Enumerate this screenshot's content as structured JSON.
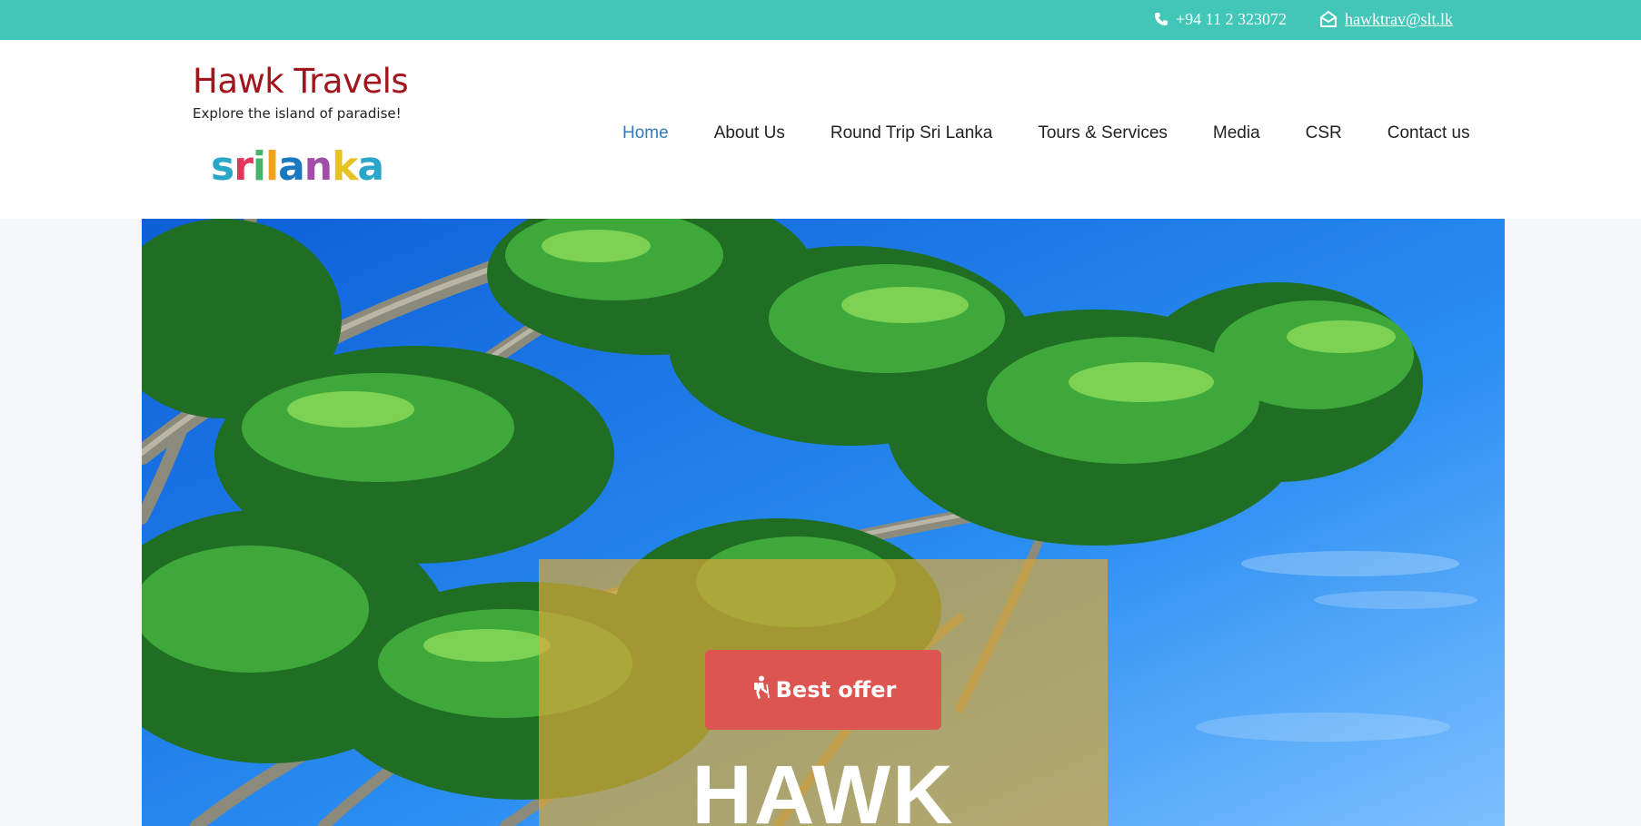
{
  "topbar": {
    "phone": "+94 11 2 323072",
    "email": "hawktrav@slt.lk",
    "phone_icon": "phone-icon",
    "email_icon": "envelope-open-icon",
    "bg_color": "#42c6b8"
  },
  "logo": {
    "brand": "Hawk Travels",
    "tagline": "Explore the island of paradise!",
    "srilanka_letters": [
      "s",
      "r",
      "i",
      "l",
      "a",
      "n",
      "k",
      "a"
    ]
  },
  "nav": {
    "items": [
      {
        "label": "Home",
        "active": true
      },
      {
        "label": "About Us"
      },
      {
        "label": "Round Trip Sri Lanka"
      },
      {
        "label": "Tours & Services"
      },
      {
        "label": "Media"
      },
      {
        "label": "CSR"
      },
      {
        "label": "Contact us"
      }
    ],
    "active_color": "#2f7dc4"
  },
  "hero": {
    "button_label": "Best offer",
    "button_icon": "hiking-person-icon",
    "button_color": "#dd5550",
    "title": "HAWK",
    "image": "palm-trees-sky-photo"
  }
}
